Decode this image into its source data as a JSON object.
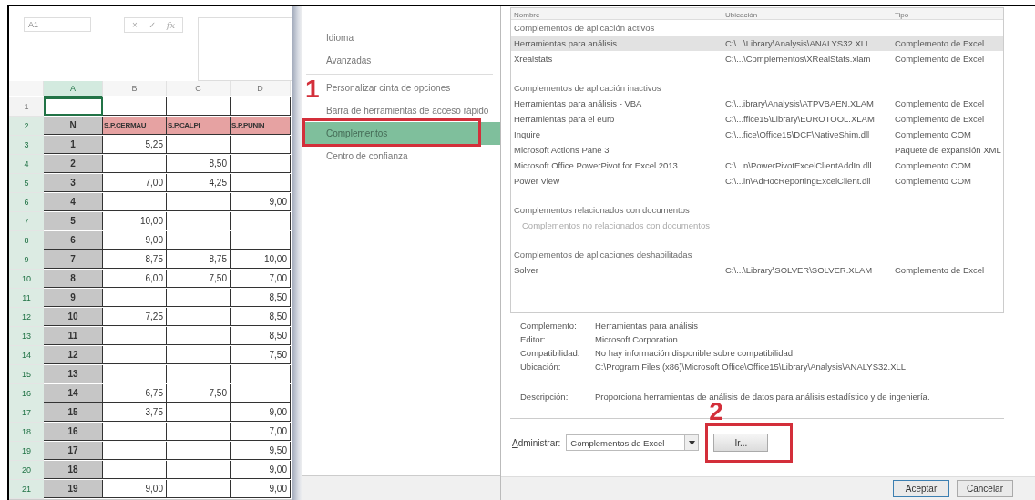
{
  "spreadsheet": {
    "name_box": "A1",
    "formula_icons": [
      "×",
      "✓",
      "fx"
    ],
    "columns": [
      {
        "label": "A",
        "selected": true
      },
      {
        "label": "B",
        "selected": false
      },
      {
        "label": "C",
        "selected": false
      },
      {
        "label": "D",
        "selected": false
      }
    ],
    "rows": [
      {
        "number": "1",
        "selected": false,
        "kind": "data",
        "cells": {}
      },
      {
        "number": "2",
        "selected": true,
        "kind": "header",
        "cells": {
          "a": "N",
          "b": "S.P.CERMAU",
          "c": "S.P.CALPI",
          "d": "S.P.PUNIN"
        }
      },
      {
        "number": "3",
        "selected": true,
        "kind": "data",
        "cells": {
          "a": "1",
          "b": "5,25"
        }
      },
      {
        "number": "4",
        "selected": true,
        "kind": "data",
        "cells": {
          "a": "2",
          "c": "8,50"
        }
      },
      {
        "number": "5",
        "selected": true,
        "kind": "data",
        "cells": {
          "a": "3",
          "b": "7,00",
          "c": "4,25"
        }
      },
      {
        "number": "6",
        "selected": true,
        "kind": "data",
        "cells": {
          "a": "4",
          "d": "9,00"
        }
      },
      {
        "number": "7",
        "selected": true,
        "kind": "data",
        "cells": {
          "a": "5",
          "b": "10,00"
        }
      },
      {
        "number": "8",
        "selected": true,
        "kind": "data",
        "cells": {
          "a": "6",
          "b": "9,00"
        }
      },
      {
        "number": "9",
        "selected": true,
        "kind": "data",
        "cells": {
          "a": "7",
          "b": "8,75",
          "c": "8,75",
          "d": "10,00"
        }
      },
      {
        "number": "10",
        "selected": true,
        "kind": "data",
        "cells": {
          "a": "8",
          "b": "6,00",
          "c": "7,50",
          "d": "7,00"
        }
      },
      {
        "number": "11",
        "selected": true,
        "kind": "data",
        "cells": {
          "a": "9",
          "d": "8,50"
        }
      },
      {
        "number": "12",
        "selected": true,
        "kind": "data",
        "cells": {
          "a": "10",
          "b": "7,25",
          "d": "8,50"
        }
      },
      {
        "number": "13",
        "selected": true,
        "kind": "data",
        "cells": {
          "a": "11",
          "d": "8,50"
        }
      },
      {
        "number": "14",
        "selected": true,
        "kind": "data",
        "cells": {
          "a": "12",
          "d": "7,50"
        }
      },
      {
        "number": "15",
        "selected": true,
        "kind": "data",
        "cells": {
          "a": "13"
        }
      },
      {
        "number": "16",
        "selected": true,
        "kind": "data",
        "cells": {
          "a": "14",
          "b": "6,75",
          "c": "7,50"
        }
      },
      {
        "number": "17",
        "selected": true,
        "kind": "data",
        "cells": {
          "a": "15",
          "b": "3,75",
          "d": "9,00"
        }
      },
      {
        "number": "18",
        "selected": true,
        "kind": "data",
        "cells": {
          "a": "16",
          "d": "7,00"
        }
      },
      {
        "number": "19",
        "selected": true,
        "kind": "data",
        "cells": {
          "a": "17",
          "d": "9,50"
        }
      },
      {
        "number": "20",
        "selected": true,
        "kind": "data",
        "cells": {
          "a": "18",
          "d": "9,00"
        }
      },
      {
        "number": "21",
        "selected": true,
        "kind": "data",
        "cells": {
          "a": "19",
          "b": "9,00",
          "d": "9,00"
        }
      }
    ]
  },
  "options_sidebar": {
    "items": [
      {
        "label": "Idioma",
        "selected": false,
        "divider_after": false
      },
      {
        "label": "Avanzadas",
        "selected": false,
        "divider_after": true
      },
      {
        "label": "Personalizar cinta de opciones",
        "selected": false,
        "divider_after": false
      },
      {
        "label": "Barra de herramientas de acceso rápido",
        "selected": false,
        "divider_after": false
      },
      {
        "label": "Complementos",
        "selected": true,
        "divider_after": false
      },
      {
        "label": "Centro de confianza",
        "selected": false,
        "divider_after": false
      }
    ]
  },
  "addins": {
    "columns": [
      "Nombre",
      "Ubicación",
      "Tipo"
    ],
    "groups": [
      {
        "title": "Complementos de aplicación activos",
        "items": [
          {
            "kind": "addin",
            "name": "Herramientas para análisis",
            "location": "C:\\...\\Library\\Analysis\\ANALYS32.XLL",
            "type": "Complemento de Excel",
            "selected": true
          },
          {
            "kind": "addin",
            "name": "Xrealstats",
            "location": "C:\\...\\Complementos\\XRealStats.xlam",
            "type": "Complemento de Excel",
            "selected": false
          }
        ]
      },
      {
        "title": "Complementos de aplicación inactivos",
        "items": [
          {
            "kind": "addin",
            "name": "Herramientas para análisis - VBA",
            "location": "C:\\...ibrary\\Analysis\\ATPVBAEN.XLAM",
            "type": "Complemento de Excel",
            "selected": false
          },
          {
            "kind": "addin",
            "name": "Herramientas para el euro",
            "location": "C:\\...ffice15\\Library\\EUROTOOL.XLAM",
            "type": "Complemento de Excel",
            "selected": false
          },
          {
            "kind": "addin",
            "name": "Inquire",
            "location": "C:\\...fice\\Office15\\DCF\\NativeShim.dll",
            "type": "Complemento COM",
            "selected": false
          },
          {
            "kind": "addin",
            "name": "Microsoft Actions Pane 3",
            "type": "Paquete de expansión XML",
            "selected": false
          },
          {
            "kind": "addin",
            "name": "Microsoft Office PowerPivot for Excel 2013",
            "location": "C:\\...n\\PowerPivotExcelClientAddIn.dll",
            "type": "Complemento COM",
            "selected": false
          },
          {
            "kind": "addin",
            "name": "Power View",
            "location": "C:\\...in\\AdHocReportingExcelClient.dll",
            "type": "Complemento COM",
            "selected": false
          }
        ]
      },
      {
        "title": "Complementos relacionados con documentos",
        "items": [
          {
            "kind": "empty",
            "name": "Complementos no relacionados con documentos"
          }
        ]
      },
      {
        "title": "Complementos de aplicaciones deshabilitadas",
        "items": [
          {
            "kind": "addin",
            "name": "Solver",
            "location": "C:\\...\\Library\\SOLVER\\SOLVER.XLAM",
            "type": "Complemento de Excel",
            "selected": false
          }
        ]
      }
    ]
  },
  "details": [
    {
      "label": "Complemento:",
      "value": "Herramientas para análisis"
    },
    {
      "label": "Editor:",
      "value": "Microsoft Corporation"
    },
    {
      "label": "Compatibilidad:",
      "value": "No hay información disponible sobre compatibilidad"
    },
    {
      "label": "Ubicación:",
      "value": "C:\\Program Files (x86)\\Microsoft Office\\Office15\\Library\\Analysis\\ANALYS32.XLL"
    },
    {
      "label": "Descripción:",
      "value": "Proporciona herramientas de análisis de datos para análisis estadístico y de ingeniería."
    }
  ],
  "manage": {
    "label": "Administrar:",
    "value": "Complementos de Excel",
    "go_button": "Ir..."
  },
  "footer_buttons": [
    "Aceptar",
    "Cancelar"
  ],
  "annotations": [
    "1",
    "2"
  ]
}
